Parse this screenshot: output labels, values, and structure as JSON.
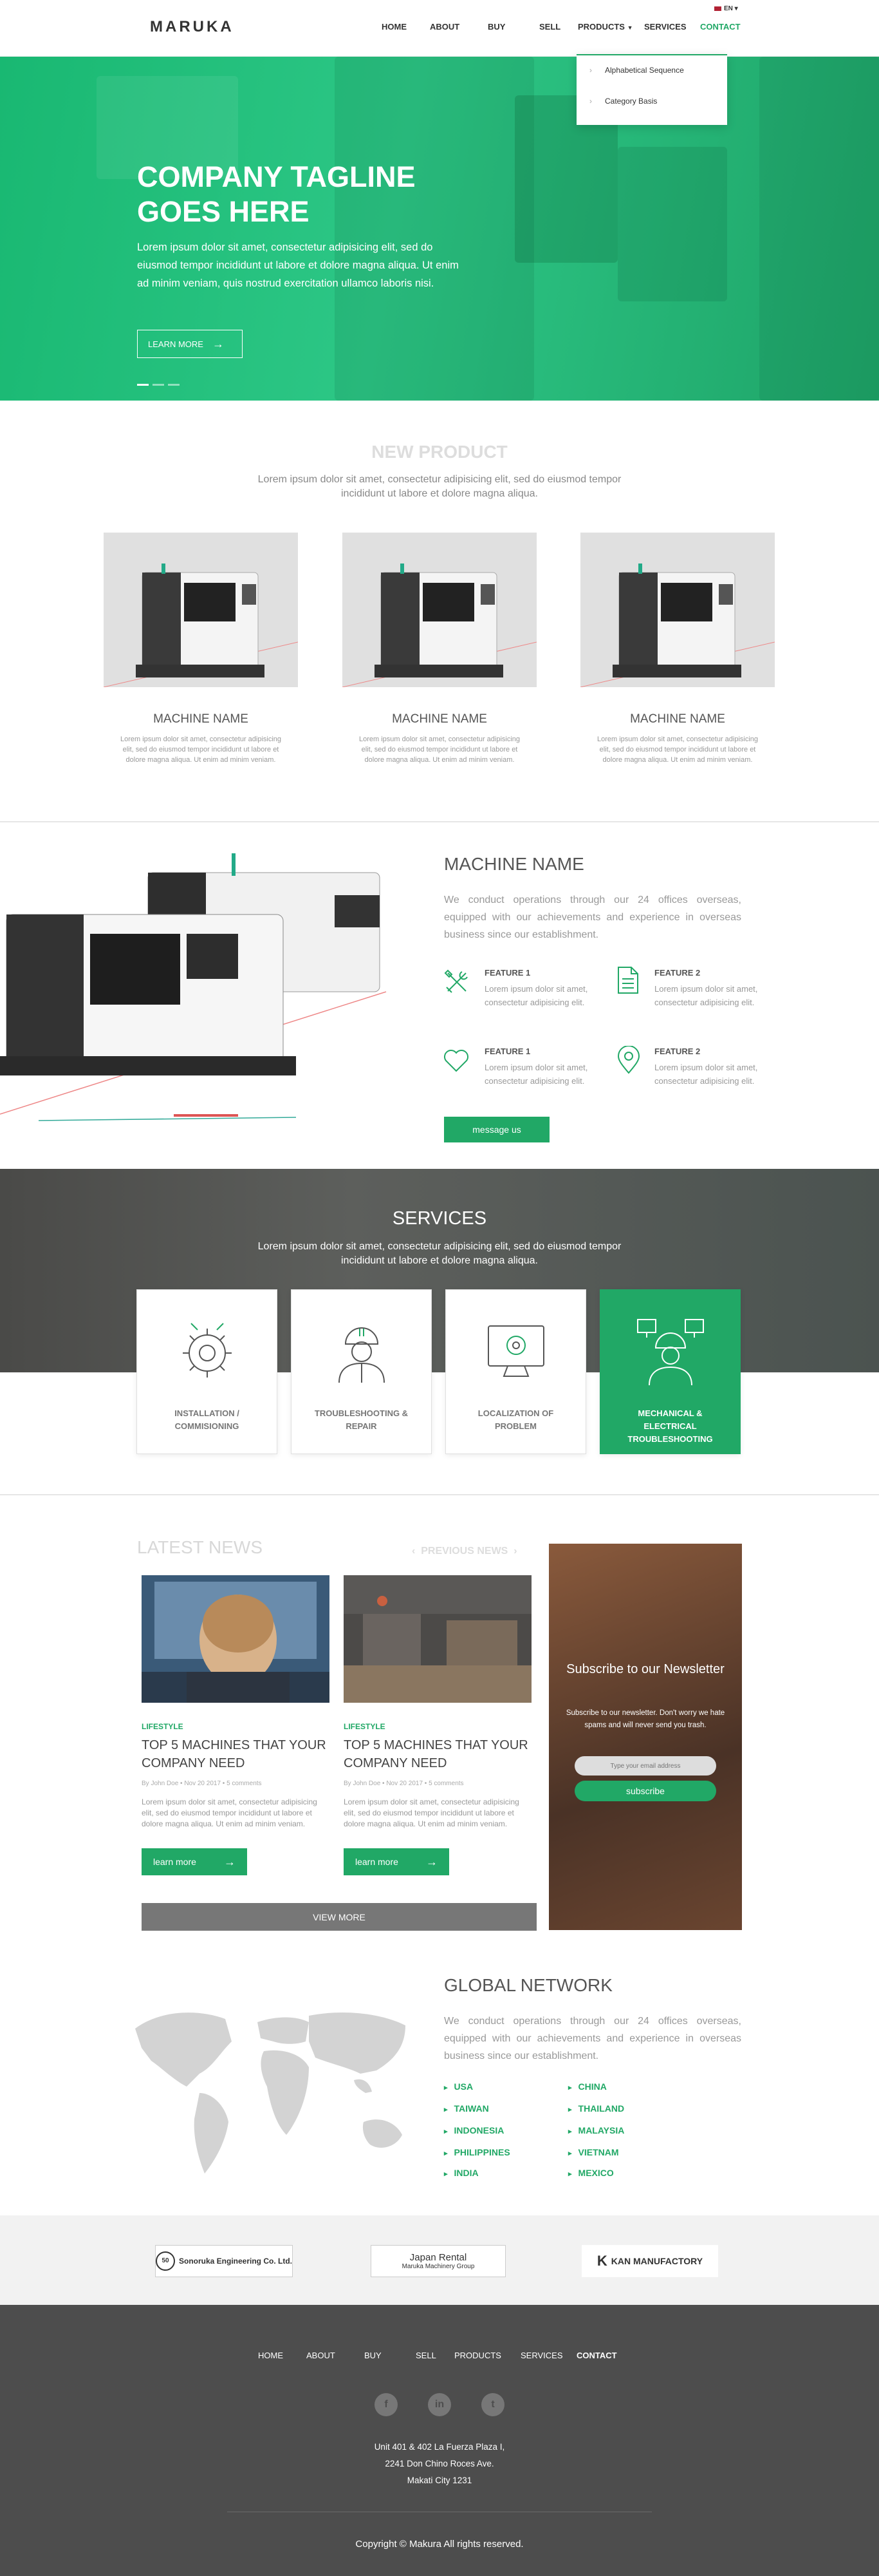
{
  "header": {
    "logo": "MARUKA",
    "lang": "EN",
    "nav": [
      "HOME",
      "ABOUT",
      "BUY",
      "SELL",
      "PRODUCTS",
      "SERVICES",
      "CONTACT"
    ],
    "dropdown": [
      "Alphabetical Sequence",
      "Category Basis"
    ]
  },
  "hero": {
    "title": "COMPANY TAGLINE GOES HERE",
    "text": "Lorem ipsum dolor sit amet, consectetur adipisicing elit, sed do eiusmod tempor incididunt ut labore et dolore magna aliqua. Ut enim ad minim veniam, quis nostrud exercitation ullamco laboris nisi.",
    "button": "LEARN MORE",
    "slides": 3,
    "active_slide": 1
  },
  "new_product": {
    "title": "NEW PRODUCT",
    "subtitle": "Lorem ipsum dolor sit amet, consectetur adipisicing elit, sed do eiusmod tempor incididunt ut labore et dolore magna aliqua.",
    "products": [
      {
        "name": "MACHINE NAME",
        "desc": "Lorem ipsum dolor sit amet, consectetur adipisicing elit, sed do eiusmod tempor incididunt ut labore et dolore magna aliqua. Ut enim ad minim veniam."
      },
      {
        "name": "MACHINE NAME",
        "desc": "Lorem ipsum dolor sit amet, consectetur adipisicing elit, sed do eiusmod tempor incididunt ut labore et dolore magna aliqua. Ut enim ad minim veniam."
      },
      {
        "name": "MACHINE NAME",
        "desc": "Lorem ipsum dolor sit amet, consectetur adipisicing elit, sed do eiusmod tempor incididunt ut labore et dolore magna aliqua. Ut enim ad minim veniam."
      }
    ]
  },
  "machine": {
    "title": "MACHINE NAME",
    "text": "We conduct operations through our 24 offices overseas, equipped with our achievements and experience in overseas business since our establishment.",
    "features": [
      {
        "title": "FEATURE 1",
        "desc": "Lorem ipsum dolor sit amet, consectetur adipisicing elit.",
        "icon": "tools-icon"
      },
      {
        "title": "FEATURE 2",
        "desc": "Lorem ipsum dolor sit amet, consectetur adipisicing elit.",
        "icon": "document-icon"
      },
      {
        "title": "FEATURE 1",
        "desc": "Lorem ipsum dolor sit amet, consectetur adipisicing elit.",
        "icon": "heart-icon"
      },
      {
        "title": "FEATURE 2",
        "desc": "Lorem ipsum dolor sit amet, consectetur adipisicing elit.",
        "icon": "location-pin-icon"
      }
    ],
    "button": "message us"
  },
  "services": {
    "title": "SERVICES",
    "subtitle": "Lorem ipsum dolor sit amet, consectetur adipisicing elit, sed do eiusmod tempor incididunt ut labore et dolore magna aliqua.",
    "items": [
      {
        "label": "INSTALLATION / COMMISIONING",
        "icon": "wrench-gear-icon"
      },
      {
        "label": "TROUBLESHOOTING & REPAIR",
        "icon": "engineer-icon"
      },
      {
        "label": "LOCALIZATION OF PROBLEM",
        "icon": "monitor-gear-icon"
      },
      {
        "label": "MECHANICAL & ELECTRICAL TROUBLESHOOTING",
        "icon": "engineer-screens-icon"
      }
    ]
  },
  "news": {
    "title": "LATEST NEWS",
    "previous": "PREVIOUS NEWS",
    "articles": [
      {
        "category": "LIFESTYLE",
        "title": "TOP 5 MACHINES THAT YOUR COMPANY NEED",
        "meta": "By John Doe  •  Nov 20 2017  •  5 comments",
        "desc": "Lorem ipsum dolor sit amet, consectetur adipisicing elit, sed do eiusmod tempor incididunt ut labore et dolore magna aliqua. Ut enim ad minim veniam.",
        "button": "learn more"
      },
      {
        "category": "LIFESTYLE",
        "title": "TOP 5 MACHINES THAT YOUR COMPANY NEED",
        "meta": "By John Doe  •  Nov 20 2017  •  5 comments",
        "desc": "Lorem ipsum dolor sit amet, consectetur adipisicing elit, sed do eiusmod tempor incididunt ut labore et dolore magna aliqua. Ut enim ad minim veniam.",
        "button": "learn more"
      }
    ],
    "view_more": "VIEW MORE",
    "newsletter": {
      "title": "Subscribe to our Newsletter",
      "text": "Subscribe to our newsletter. Don't worry we hate spams and will never send you trash.",
      "placeholder": "Type your email address",
      "button": "subscribe"
    }
  },
  "global": {
    "title": "GLOBAL NETWORK",
    "text": "We conduct operations through our 24 offices overseas, equipped with our achievements and experience in overseas business since our establishment.",
    "countries": [
      "USA",
      "CHINA",
      "TAIWAN",
      "THAILAND",
      "INDONESIA",
      "MALAYSIA",
      "PHILIPPINES",
      "VIETNAM",
      "INDIA",
      "MEXICO"
    ]
  },
  "partners": [
    "Sonoruka Engineering Co. Ltd.",
    "Japan Rental",
    "KAN MANUFACTORY"
  ],
  "partner_sub": "Maruka Machinery Group",
  "footer": {
    "nav": [
      "HOME",
      "ABOUT",
      "BUY",
      "SELL",
      "PRODUCTS",
      "SERVICES",
      "CONTACT"
    ],
    "social": [
      "facebook-icon",
      "linkedin-icon",
      "twitter-icon"
    ],
    "address": [
      "Unit 401 & 402 La Fuerza Plaza I,",
      "2241 Don Chino Roces Ave.",
      "Makati City 1231"
    ],
    "copyright": "Copyright © Makura All rights reserved."
  },
  "colors": {
    "accent": "#21a866",
    "footer": "#4d4d4d",
    "partner_bar": "#f2f2f2"
  }
}
